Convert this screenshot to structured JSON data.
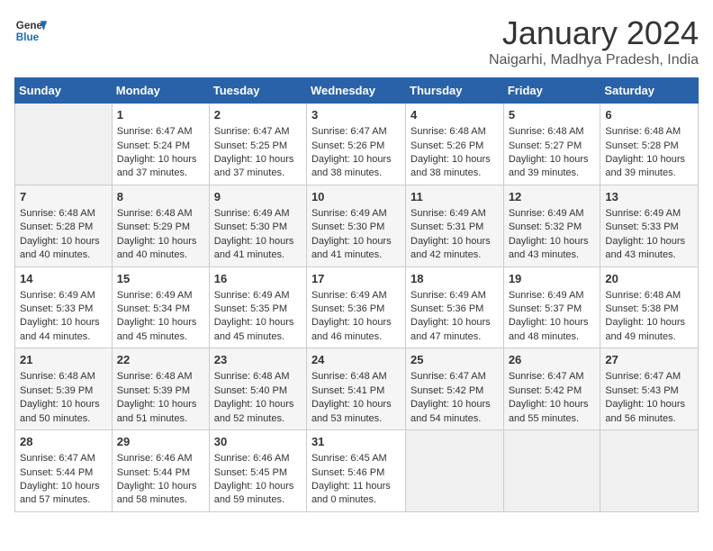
{
  "header": {
    "logo_line1": "General",
    "logo_line2": "Blue",
    "title": "January 2024",
    "subtitle": "Naigarhi, Madhya Pradesh, India"
  },
  "columns": [
    "Sunday",
    "Monday",
    "Tuesday",
    "Wednesday",
    "Thursday",
    "Friday",
    "Saturday"
  ],
  "weeks": [
    [
      {
        "day": "",
        "empty": true
      },
      {
        "day": "1",
        "sunrise": "6:47 AM",
        "sunset": "5:24 PM",
        "daylight": "10 hours and 37 minutes."
      },
      {
        "day": "2",
        "sunrise": "6:47 AM",
        "sunset": "5:25 PM",
        "daylight": "10 hours and 37 minutes."
      },
      {
        "day": "3",
        "sunrise": "6:47 AM",
        "sunset": "5:26 PM",
        "daylight": "10 hours and 38 minutes."
      },
      {
        "day": "4",
        "sunrise": "6:48 AM",
        "sunset": "5:26 PM",
        "daylight": "10 hours and 38 minutes."
      },
      {
        "day": "5",
        "sunrise": "6:48 AM",
        "sunset": "5:27 PM",
        "daylight": "10 hours and 39 minutes."
      },
      {
        "day": "6",
        "sunrise": "6:48 AM",
        "sunset": "5:28 PM",
        "daylight": "10 hours and 39 minutes."
      }
    ],
    [
      {
        "day": "7",
        "sunrise": "6:48 AM",
        "sunset": "5:28 PM",
        "daylight": "10 hours and 40 minutes."
      },
      {
        "day": "8",
        "sunrise": "6:48 AM",
        "sunset": "5:29 PM",
        "daylight": "10 hours and 40 minutes."
      },
      {
        "day": "9",
        "sunrise": "6:49 AM",
        "sunset": "5:30 PM",
        "daylight": "10 hours and 41 minutes."
      },
      {
        "day": "10",
        "sunrise": "6:49 AM",
        "sunset": "5:30 PM",
        "daylight": "10 hours and 41 minutes."
      },
      {
        "day": "11",
        "sunrise": "6:49 AM",
        "sunset": "5:31 PM",
        "daylight": "10 hours and 42 minutes."
      },
      {
        "day": "12",
        "sunrise": "6:49 AM",
        "sunset": "5:32 PM",
        "daylight": "10 hours and 43 minutes."
      },
      {
        "day": "13",
        "sunrise": "6:49 AM",
        "sunset": "5:33 PM",
        "daylight": "10 hours and 43 minutes."
      }
    ],
    [
      {
        "day": "14",
        "sunrise": "6:49 AM",
        "sunset": "5:33 PM",
        "daylight": "10 hours and 44 minutes."
      },
      {
        "day": "15",
        "sunrise": "6:49 AM",
        "sunset": "5:34 PM",
        "daylight": "10 hours and 45 minutes."
      },
      {
        "day": "16",
        "sunrise": "6:49 AM",
        "sunset": "5:35 PM",
        "daylight": "10 hours and 45 minutes."
      },
      {
        "day": "17",
        "sunrise": "6:49 AM",
        "sunset": "5:36 PM",
        "daylight": "10 hours and 46 minutes."
      },
      {
        "day": "18",
        "sunrise": "6:49 AM",
        "sunset": "5:36 PM",
        "daylight": "10 hours and 47 minutes."
      },
      {
        "day": "19",
        "sunrise": "6:49 AM",
        "sunset": "5:37 PM",
        "daylight": "10 hours and 48 minutes."
      },
      {
        "day": "20",
        "sunrise": "6:48 AM",
        "sunset": "5:38 PM",
        "daylight": "10 hours and 49 minutes."
      }
    ],
    [
      {
        "day": "21",
        "sunrise": "6:48 AM",
        "sunset": "5:39 PM",
        "daylight": "10 hours and 50 minutes."
      },
      {
        "day": "22",
        "sunrise": "6:48 AM",
        "sunset": "5:39 PM",
        "daylight": "10 hours and 51 minutes."
      },
      {
        "day": "23",
        "sunrise": "6:48 AM",
        "sunset": "5:40 PM",
        "daylight": "10 hours and 52 minutes."
      },
      {
        "day": "24",
        "sunrise": "6:48 AM",
        "sunset": "5:41 PM",
        "daylight": "10 hours and 53 minutes."
      },
      {
        "day": "25",
        "sunrise": "6:47 AM",
        "sunset": "5:42 PM",
        "daylight": "10 hours and 54 minutes."
      },
      {
        "day": "26",
        "sunrise": "6:47 AM",
        "sunset": "5:42 PM",
        "daylight": "10 hours and 55 minutes."
      },
      {
        "day": "27",
        "sunrise": "6:47 AM",
        "sunset": "5:43 PM",
        "daylight": "10 hours and 56 minutes."
      }
    ],
    [
      {
        "day": "28",
        "sunrise": "6:47 AM",
        "sunset": "5:44 PM",
        "daylight": "10 hours and 57 minutes."
      },
      {
        "day": "29",
        "sunrise": "6:46 AM",
        "sunset": "5:44 PM",
        "daylight": "10 hours and 58 minutes."
      },
      {
        "day": "30",
        "sunrise": "6:46 AM",
        "sunset": "5:45 PM",
        "daylight": "10 hours and 59 minutes."
      },
      {
        "day": "31",
        "sunrise": "6:45 AM",
        "sunset": "5:46 PM",
        "daylight": "11 hours and 0 minutes."
      },
      {
        "day": "",
        "empty": true
      },
      {
        "day": "",
        "empty": true
      },
      {
        "day": "",
        "empty": true
      }
    ]
  ]
}
